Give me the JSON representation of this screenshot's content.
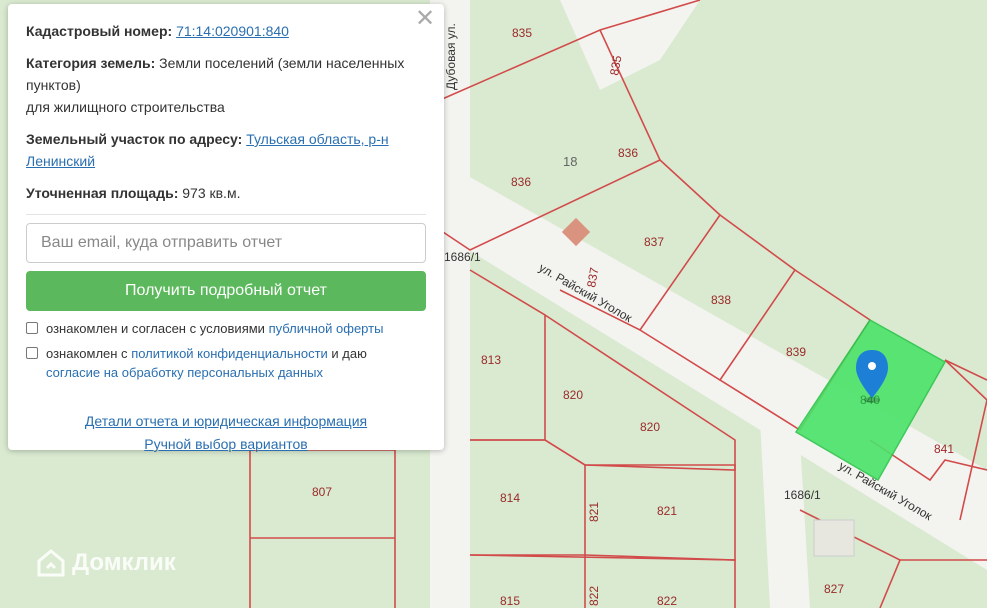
{
  "popup": {
    "cadastral_label": "Кадастровый номер:",
    "cadastral_value": "71:14:020901:840",
    "category_label": "Категория земель:",
    "category_value": "Земли поселений (земли населенных пунктов)",
    "category_use": "для жилищного строительства",
    "address_label": "Земельный участок по адресу:",
    "address_value": "Тульская область, р-н Ленинский",
    "area_label": "Уточненная площадь:",
    "area_value": "973 кв.м.",
    "email_placeholder": "Ваш email, куда отправить отчет",
    "submit_label": "Получить подробный отчет",
    "consent1_text": "ознакомлен и согласен с условиями ",
    "consent1_link": "публичной оферты",
    "consent2_text": "ознакомлен с ",
    "consent2_link": "политикой конфиденциальности",
    "consent2_mid": " и даю ",
    "consent2_link2": "согласие на обработку персональных данных",
    "details_link": "Детали отчета и юридическая информация",
    "manual_link": "Ручной выбор вариантов",
    "close_glyph": "✕"
  },
  "map": {
    "plots": [
      "835",
      "835",
      "836",
      "836",
      "837",
      "837",
      "838",
      "839",
      "840",
      "841",
      "813",
      "820",
      "820",
      "814",
      "821",
      "821",
      "807",
      "815",
      "822",
      "822",
      "827"
    ],
    "quarter": "18",
    "road_labels": [
      "1686/1",
      "1686/1"
    ],
    "streets": [
      "ул. Райский Уголок",
      "ул. Райский Уголок",
      "Дубовая ул."
    ],
    "colors": {
      "selected_plot": "#4be36a",
      "marker": "#1e7fd6",
      "boundary": "#d24b4b"
    }
  },
  "brand": {
    "logo_text": "Домклик"
  }
}
